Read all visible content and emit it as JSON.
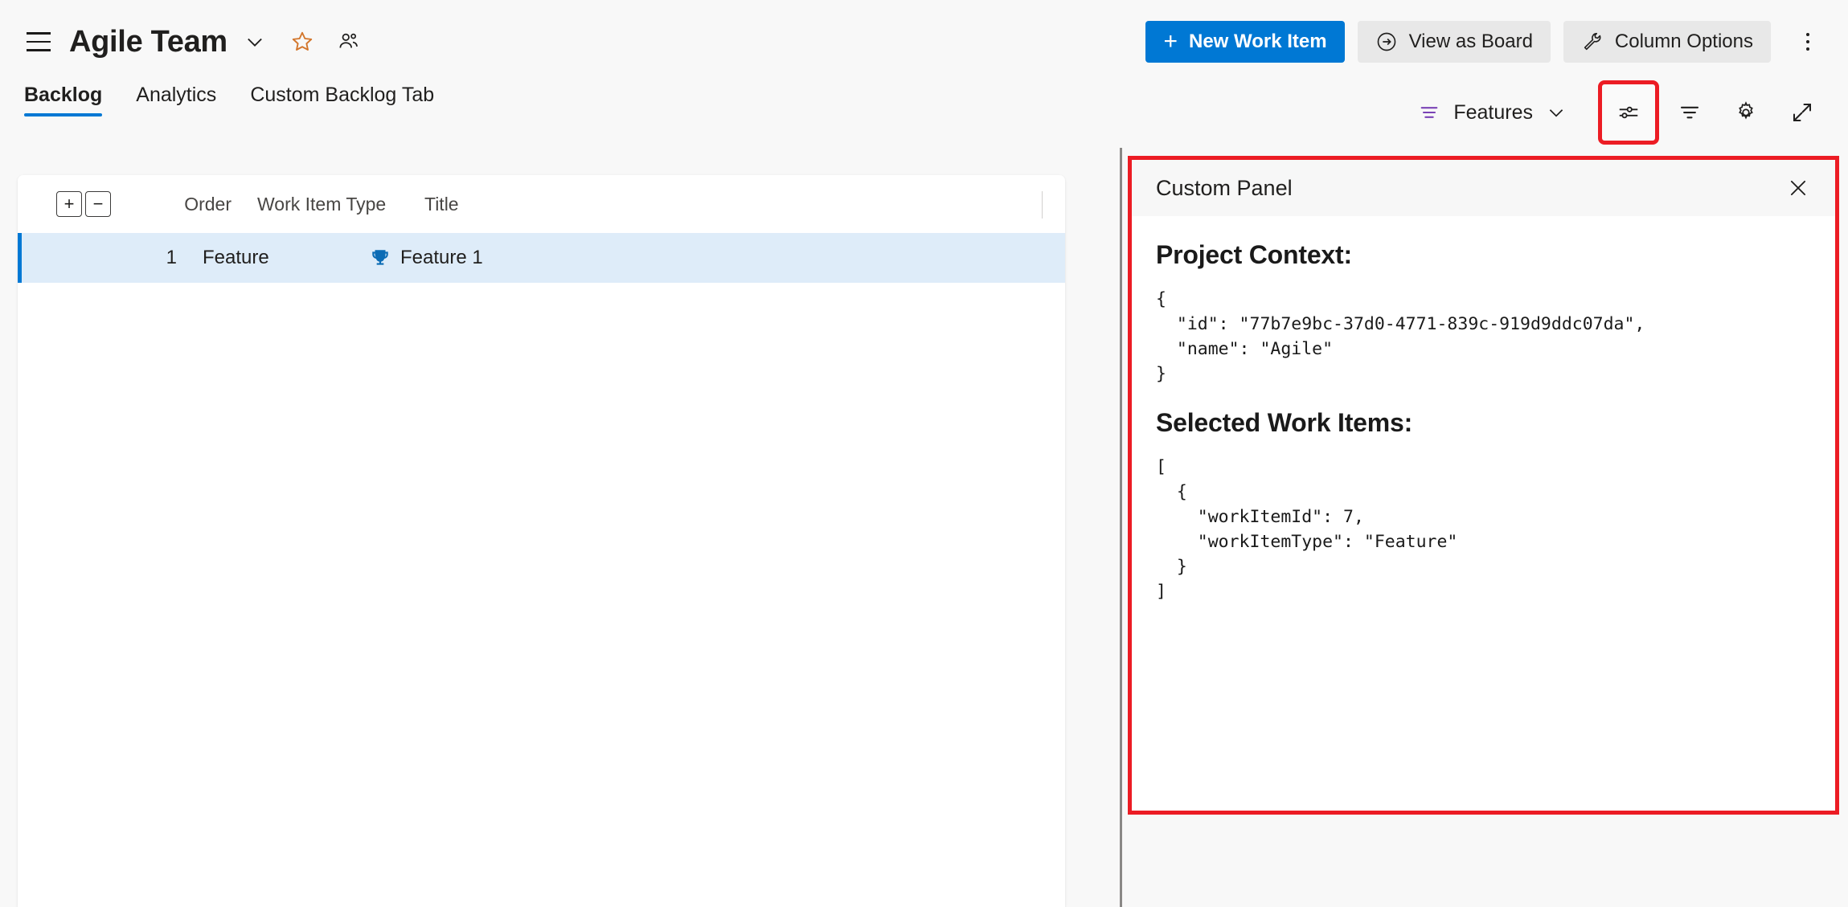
{
  "header": {
    "menu_icon": "hamburger-icon",
    "team_title": "Agile Team",
    "team_chevron_icon": "chevron-down-icon",
    "favorite_icon": "star-icon",
    "members_icon": "people-icon",
    "new_work_item_label": "New Work Item",
    "new_work_item_icon": "plus-icon",
    "view_as_board_label": "View as Board",
    "view_as_board_icon": "arrow-circle-right-icon",
    "column_options_label": "Column Options",
    "column_options_icon": "wrench-icon",
    "more_actions_icon": "more-vertical-icon",
    "primary_color": "#0078d4",
    "secondary_bg": "#e8e8e8"
  },
  "tabs": {
    "items": [
      {
        "label": "Backlog",
        "active": true
      },
      {
        "label": "Analytics",
        "active": false
      },
      {
        "label": "Custom Backlog Tab",
        "active": false
      }
    ],
    "active_underline_color": "#0078d4"
  },
  "toolbar": {
    "backlog_level_icon": "backlog-levels-icon",
    "backlog_level_label": "Features",
    "backlog_level_chevron": "chevron-down-icon",
    "view_options_icon": "view-options-sliders-icon",
    "filter_icon": "filter-icon",
    "settings_icon": "gear-icon",
    "fullscreen_icon": "expand-diagonal-icon",
    "highlight_color": "#ec1c24"
  },
  "grid": {
    "expand_all_label": "+",
    "collapse_all_label": "−",
    "columns": [
      "Order",
      "Work Item Type",
      "Title"
    ],
    "rows": [
      {
        "order": "1",
        "work_item_type": "Feature",
        "title": "Feature 1",
        "type_icon": "trophy-icon",
        "selected": true
      }
    ],
    "selected_row_bg": "#deecf9",
    "selected_row_accent": "#0078d4"
  },
  "panel": {
    "title": "Custom Panel",
    "close_icon": "close-icon",
    "project_context_heading": "Project Context:",
    "project_context_json": "{\n  \"id\": \"77b7e9bc-37d0-4771-839c-919d9ddc07da\",\n  \"name\": \"Agile\"\n}",
    "selected_work_items_heading": "Selected Work Items:",
    "selected_work_items_json": "[\n  {\n    \"workItemId\": 7,\n    \"workItemType\": \"Feature\"\n  }\n]",
    "border_color": "#ec1c24"
  }
}
